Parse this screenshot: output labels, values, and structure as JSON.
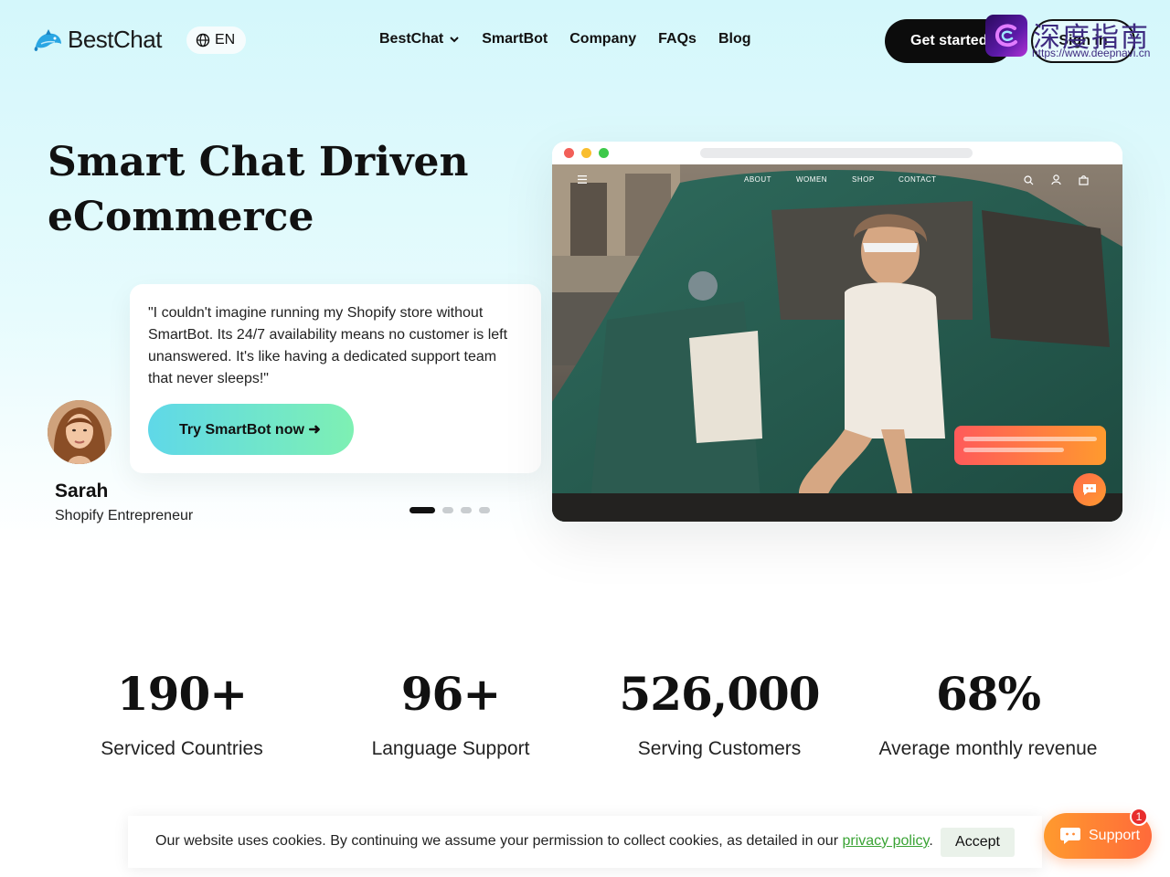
{
  "header": {
    "brand": "BestChat",
    "language": "EN",
    "nav": [
      {
        "label": "BestChat",
        "has_dropdown": true
      },
      {
        "label": "SmartBot"
      },
      {
        "label": "Company"
      },
      {
        "label": "FAQs"
      },
      {
        "label": "Blog"
      }
    ],
    "get_started_label": "Get started",
    "sign_in_label": "Sign in"
  },
  "watermark": {
    "title": "深度指南",
    "url": "https://www.deepnavi.cn"
  },
  "hero": {
    "title_line1": "Smart Chat Driven",
    "title_line2": "eCommerce",
    "testimonial": {
      "quote": "\"I couldn't imagine running my Shopify store without SmartBot. Its 24/7 availability means no customer is left unanswered. It's like having a dedicated support team that never sleeps!\"",
      "cta_label": "Try SmartBot now ➜",
      "author_name": "Sarah",
      "author_role": "Shopify Entrepreneur"
    },
    "carousel": {
      "total": 4,
      "active_index": 0
    },
    "mockup": {
      "nav_items": [
        "ABOUT",
        "WOMEN",
        "SHOP",
        "CONTACT"
      ]
    }
  },
  "stats": [
    {
      "value": "190+",
      "label": "Serviced Countries"
    },
    {
      "value": "96+",
      "label": "Language Support"
    },
    {
      "value": "526,000",
      "label": "Serving Customers"
    },
    {
      "value": "68%",
      "label": "Average monthly revenue"
    }
  ],
  "cookie": {
    "text": "Our website uses cookies. By continuing we assume your permission to collect cookies, as detailed in our",
    "link_label": "privacy policy",
    "trailing": ".",
    "accept_label": "Accept"
  },
  "support": {
    "label": "Support",
    "badge_count": "1"
  },
  "colors": {
    "accent_gradient_start": "#5fd8e8",
    "accent_gradient_end": "#7ef0b3",
    "support_orange": "#ff8a34",
    "cookie_link_green": "#3aa335",
    "badge_red": "#e82d2d"
  }
}
